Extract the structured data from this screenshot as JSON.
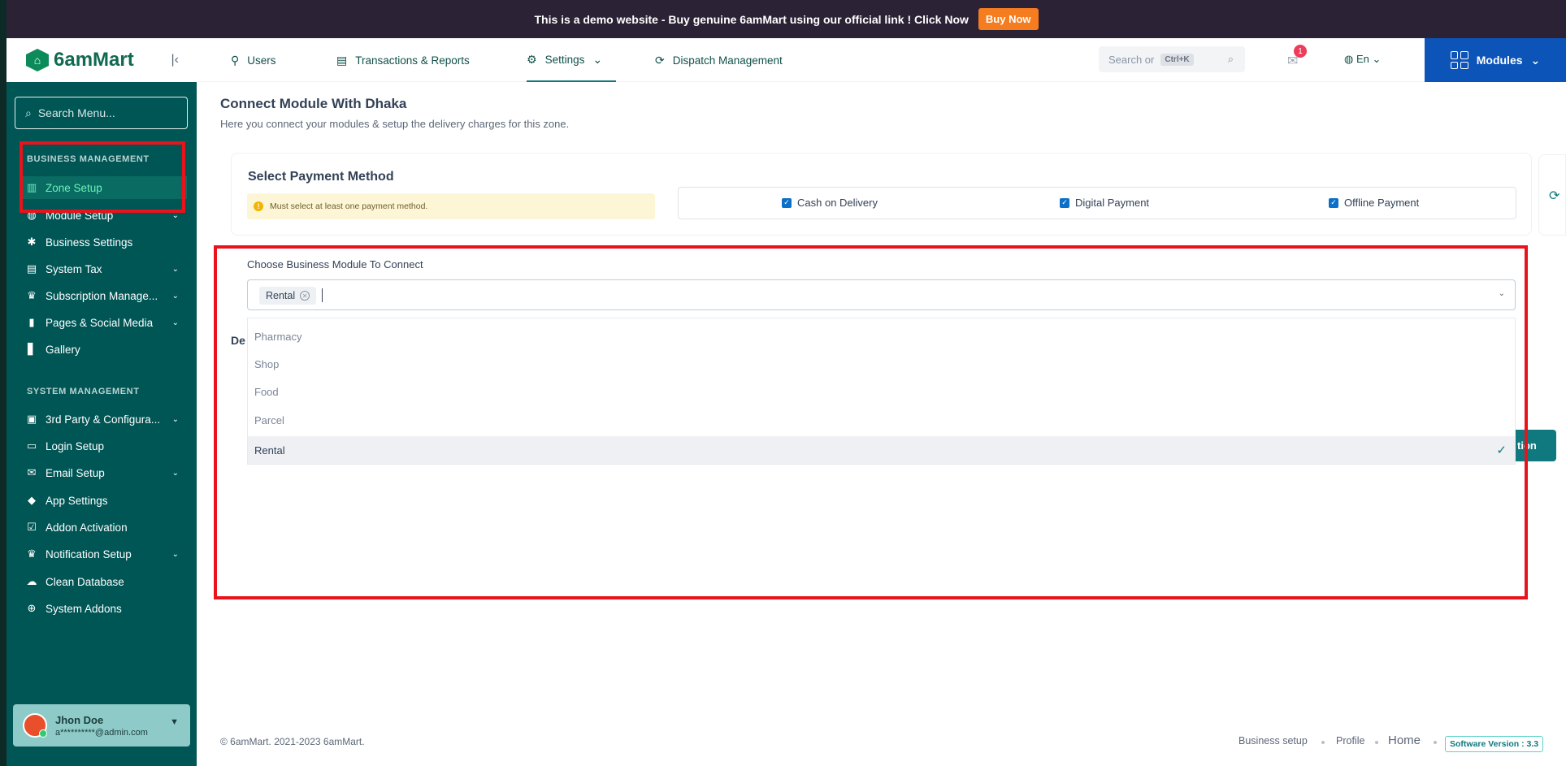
{
  "promo": {
    "text": "This is a demo website - Buy genuine 6amMart using our official link !  Click Now",
    "button": "Buy Now"
  },
  "brand": {
    "name": "6amMart"
  },
  "sidebar": {
    "search_placeholder": "Search Menu...",
    "business_label": "BUSINESS MANAGEMENT",
    "business_items": [
      {
        "label": "Zone Setup",
        "icon": "chart-icon",
        "active": true
      },
      {
        "label": "Module Setup",
        "icon": "globe-icon",
        "chevron": true
      },
      {
        "label": "Business Settings",
        "icon": "gear-icon"
      },
      {
        "label": "System Tax",
        "icon": "tax-icon",
        "chevron": true
      },
      {
        "label": "Subscription Manage...",
        "icon": "crown-icon",
        "chevron": true
      },
      {
        "label": "Pages & Social Media",
        "icon": "pages-icon",
        "chevron": true
      },
      {
        "label": "Gallery",
        "icon": "book-icon"
      }
    ],
    "system_label": "SYSTEM MANAGEMENT",
    "system_items": [
      {
        "label": "3rd Party & Configura...",
        "icon": "config-icon",
        "chevron": true
      },
      {
        "label": "Login Setup",
        "icon": "monitor-icon"
      },
      {
        "label": "Email Setup",
        "icon": "mail-icon",
        "chevron": true
      },
      {
        "label": "App Settings",
        "icon": "android-icon"
      },
      {
        "label": "Addon Activation",
        "icon": "calendar-check-icon"
      },
      {
        "label": "Notification Setup",
        "icon": "crown-icon",
        "chevron": true
      },
      {
        "label": "Clean Database",
        "icon": "cloud-icon"
      },
      {
        "label": "System Addons",
        "icon": "plus-circle-icon"
      }
    ],
    "user": {
      "name": "Jhon Doe",
      "email": "a**********@admin.com"
    }
  },
  "topnav": {
    "users": "Users",
    "transactions": "Transactions & Reports",
    "settings": "Settings",
    "dispatch": "Dispatch Management",
    "search_placeholder": "Search or",
    "shortcut": "Ctrl+K",
    "notification_count": "1",
    "language": "En",
    "modules": "Modules"
  },
  "page": {
    "title": "Connect Module With Dhaka",
    "subtitle": "Here you connect your modules & setup the delivery charges for this zone."
  },
  "payment": {
    "title": "Select Payment Method",
    "warning": "Must select at least one payment method.",
    "options": [
      "Cash on Delivery",
      "Digital Payment",
      "Offline Payment"
    ]
  },
  "module_select": {
    "label": "Choose Business Module To Connect",
    "selected_tag": "Rental",
    "options": [
      "Pharmacy",
      "Shop",
      "Food",
      "Parcel",
      "Rental"
    ],
    "selected_option": "Rental"
  },
  "peek": {
    "de": "De",
    "button": "tion"
  },
  "footer": {
    "copyright": "© 6amMart. 2021-2023 6amMart.",
    "links": [
      "Business setup",
      "Profile",
      "Home"
    ],
    "version": "Software Version : 3.3"
  }
}
